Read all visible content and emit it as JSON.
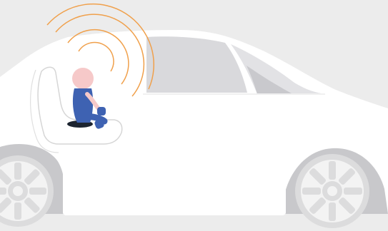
{
  "scene": {
    "description_label": "",
    "colors": {
      "background": "#ececec",
      "car_body": "#ffffff",
      "window": "#d9d9dc",
      "wheel_arch": "#c8c8cb",
      "wheel_rim": "#e9e9ea",
      "signal_waves": "#f0a04b",
      "baby_skin": "#f6c9c9",
      "baby_outfit": "#3e62b2",
      "baby_seat_base": "#1c2430",
      "car_seat_outline": "#d6d6d6"
    },
    "icons": [
      "car-icon",
      "baby-icon",
      "child-car-seat-icon",
      "wireless-signal-icon",
      "wheel-icon"
    ]
  }
}
